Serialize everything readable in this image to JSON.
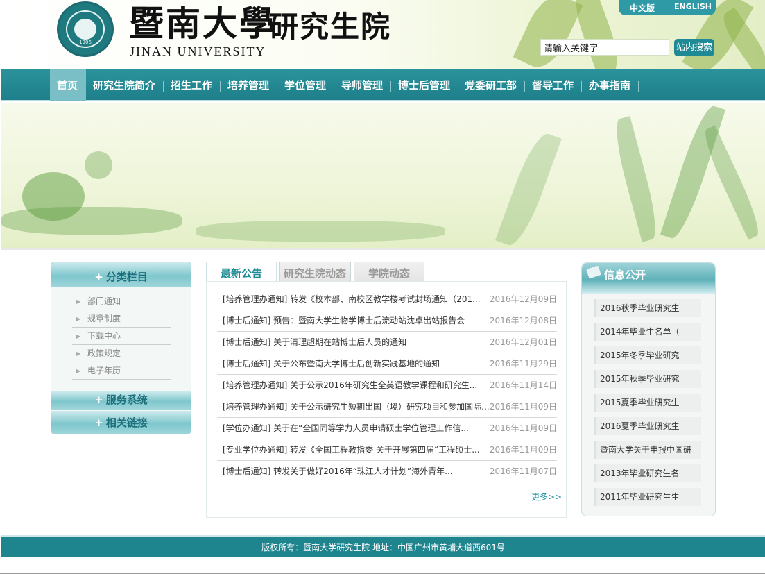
{
  "header": {
    "logo_cn": "暨南大學",
    "logo_en": "JINAN UNIVERSITY",
    "school": "研究生院",
    "seal_year": "1906",
    "lang_zh": "中文版",
    "lang_en": "ENGLISH"
  },
  "search": {
    "value": "请输入关键字",
    "button": "站内搜索"
  },
  "nav": {
    "items": [
      "首页",
      "研究生院简介",
      "招生工作",
      "培养管理",
      "学位管理",
      "导师管理",
      "博士后管理",
      "党委研工部",
      "督导工作",
      "办事指南"
    ]
  },
  "left_panel": {
    "head": "分类栏目",
    "items": [
      "部门通知",
      "规章制度",
      "下载中心",
      "政策规定",
      "电子年历"
    ],
    "service": "服务系统",
    "links": "相关链接"
  },
  "tabs": [
    "最新公告",
    "研究生院动态",
    "学院动态"
  ],
  "news": [
    {
      "title": "[培养管理办通知] 转发《校本部、南校区教学楼考试封场通知（201...",
      "date": "2016年12月09日"
    },
    {
      "title": "[博士后通知] 预告：暨南大学生物学博士后流动站沈卓出站报告会",
      "date": "2016年12月08日"
    },
    {
      "title": "[博士后通知] 关于清理超期在站博士后人员的通知",
      "date": "2016年12月01日"
    },
    {
      "title": "[博士后通知] 关于公布暨南大学博士后创新实践基地的通知",
      "date": "2016年11月29日"
    },
    {
      "title": "[培养管理办通知] 关于公示2016年研究生全英语教学课程和研究生...",
      "date": "2016年11月14日"
    },
    {
      "title": "[培养管理办通知] 关于公示研究生短期出国（境）研究项目和参加国际...",
      "date": "2016年11月09日"
    },
    {
      "title": "[学位办通知] 关于在“全国同等学力人员申请硕士学位管理工作信...",
      "date": "2016年11月09日"
    },
    {
      "title": "[专业学位办通知] 转发《全国工程教指委 关于开展第四届“工程硕士...",
      "date": "2016年11月09日"
    },
    {
      "title": "[博士后通知] 转发关于做好2016年“珠江人才计划”海外青年...",
      "date": "2016年11月07日"
    }
  ],
  "more": "更多>>",
  "info_panel": {
    "head": "信息公开",
    "items": [
      "2016秋季毕业研究生",
      "2014年毕业生名单（",
      "2015年冬季毕业研究",
      "2015年秋季毕业研究",
      "2015夏季毕业研究生",
      "2016夏季毕业研究生",
      "暨南大学关于申报中国研",
      "2013年毕业研究生名",
      "2011年毕业研究生生"
    ]
  },
  "footer": {
    "text": "版权所有：暨南大学研究生院 地址：中国广州市黄埔大道西601号"
  },
  "colors": {
    "nav": "#1d7f89",
    "accent": "#1e8a95",
    "footer": "#1e858f"
  }
}
